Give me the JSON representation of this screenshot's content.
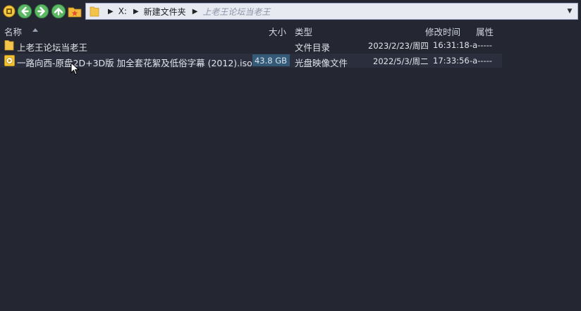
{
  "address": {
    "drive": "X:",
    "folder": "新建文件夹",
    "current": "上老王论坛当老王"
  },
  "columns": {
    "name": "名称",
    "size": "大小",
    "type": "类型",
    "modified": "修改时间",
    "attributes": "属性"
  },
  "files": [
    {
      "name": "上老王论坛当老王",
      "size": "",
      "type": "文件目录",
      "date": "2023/2/23/周四",
      "time": "16:31:18",
      "attr": "-a-----",
      "icon": "folder-icon"
    },
    {
      "name": "一路向西-原盘2D+3D版 加全套花絮及低俗字幕 (2012).iso",
      "size": "43.8 GB",
      "type": "光盘映像文件",
      "date": "2022/5/3/周二",
      "time": "17:33:56",
      "attr": "-a-----",
      "icon": "disc-image-icon"
    }
  ],
  "colors": {
    "background": "#242732",
    "selected_row": "#2a2e3d",
    "size_badge": "#355a78",
    "address_bg": "#e8eaf2",
    "folder": "#f0c44c"
  }
}
